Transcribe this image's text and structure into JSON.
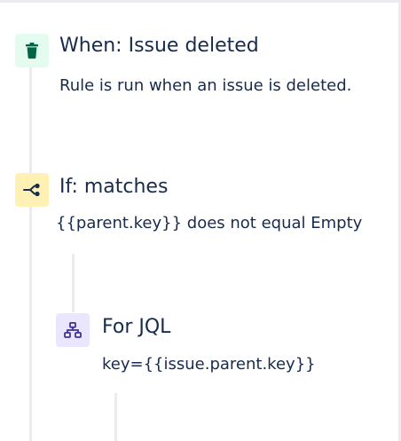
{
  "steps": [
    {
      "type": "trigger",
      "title": "When: Issue deleted",
      "description": "Rule is run when an issue is deleted.",
      "icon": "trash-icon",
      "icon_color": "#006644",
      "icon_bg": "#e3fcef"
    },
    {
      "type": "condition",
      "title": "If: matches",
      "description": "{{parent.key}} does not equal Empty",
      "icon": "branch-condition-icon",
      "icon_color": "#172b4d",
      "icon_bg": "#fff0b3"
    },
    {
      "type": "branch",
      "title": "For JQL",
      "description": "key={{issue.parent.key}}",
      "icon": "hierarchy-icon",
      "icon_color": "#403294",
      "icon_bg": "#eae6ff"
    }
  ]
}
